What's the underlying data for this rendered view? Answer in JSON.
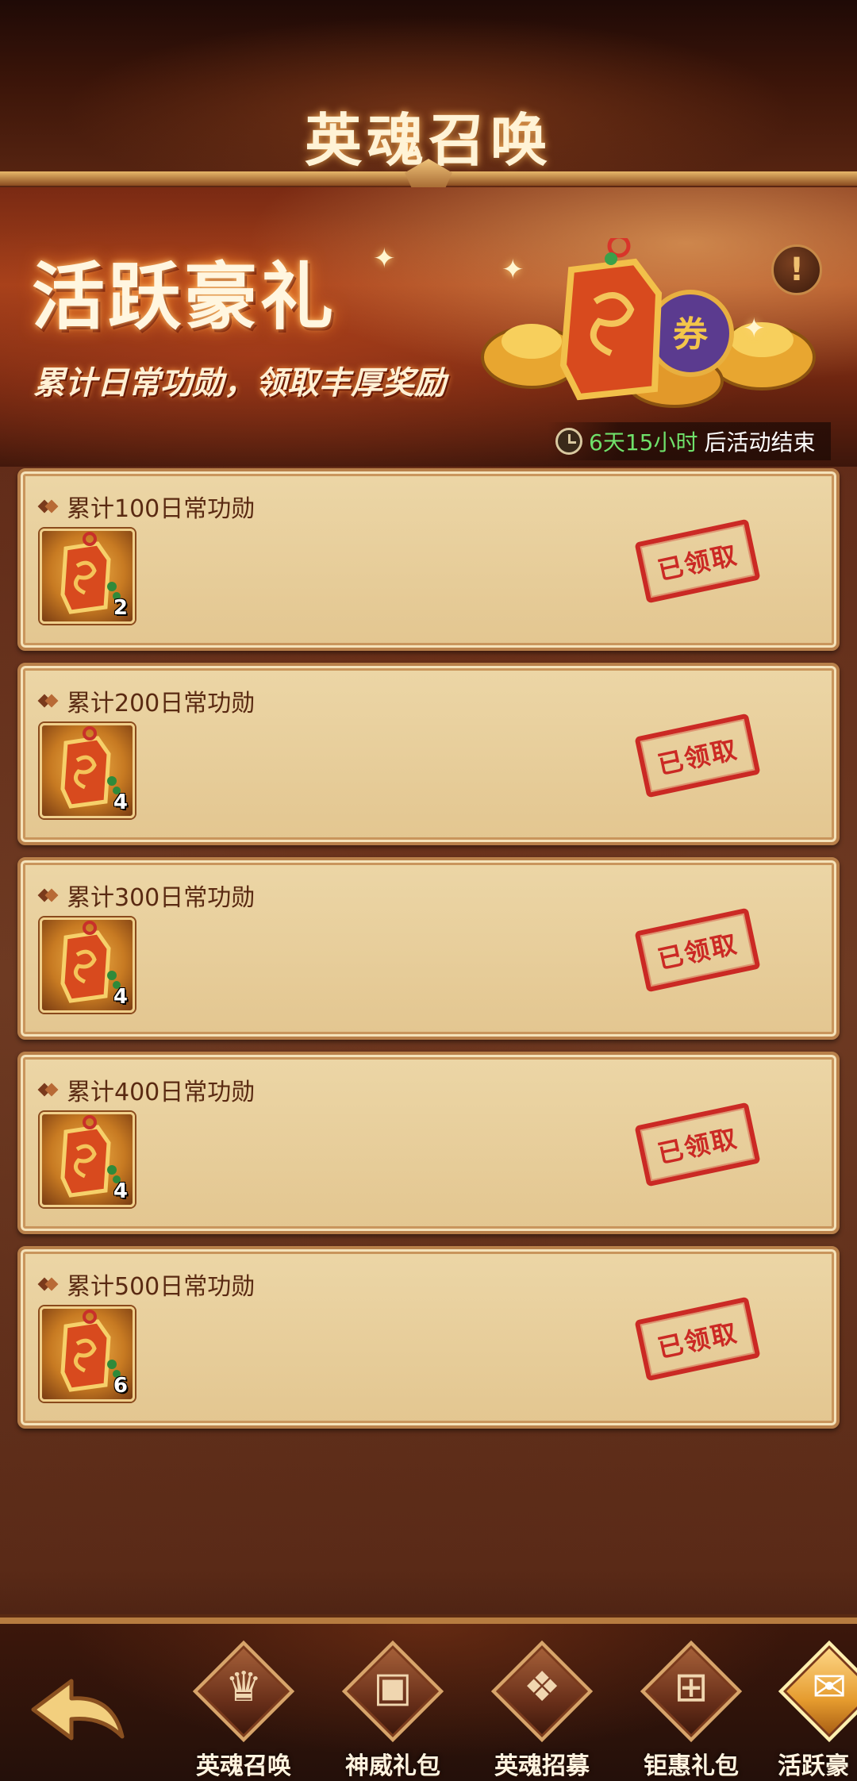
{
  "header": {
    "title": "英魂召唤"
  },
  "banner": {
    "title": "活跃豪礼",
    "subtitle": "累计日常功勋，领取丰厚奖励",
    "info_glyph": "!",
    "timer": {
      "remaining": "6天15小时",
      "suffix": "后活动结束"
    }
  },
  "rewards": [
    {
      "label": "累计100日常功勋",
      "item_count": "2",
      "status": "已领取"
    },
    {
      "label": "累计200日常功勋",
      "item_count": "4",
      "status": "已领取"
    },
    {
      "label": "累计300日常功勋",
      "item_count": "4",
      "status": "已领取"
    },
    {
      "label": "累计400日常功勋",
      "item_count": "4",
      "status": "已领取"
    },
    {
      "label": "累计500日常功勋",
      "item_count": "6",
      "status": "已领取"
    }
  ],
  "bottom_nav": {
    "tabs": [
      {
        "label": "英魂召唤",
        "icon": "crown-emblem-icon",
        "active": false
      },
      {
        "label": "神威礼包",
        "icon": "gift-box-icon",
        "active": false
      },
      {
        "label": "英魂招募",
        "icon": "flame-emblem-icon",
        "active": false
      },
      {
        "label": "钜惠礼包",
        "icon": "present-icon",
        "active": false
      },
      {
        "label": "活跃豪",
        "icon": "envelope-star-icon",
        "active": true
      }
    ]
  },
  "colors": {
    "accent_gold": "#e7b76a",
    "stamp_red": "#c81818",
    "timer_green": "#6fe06a",
    "card_bg": "#e9d09c"
  }
}
